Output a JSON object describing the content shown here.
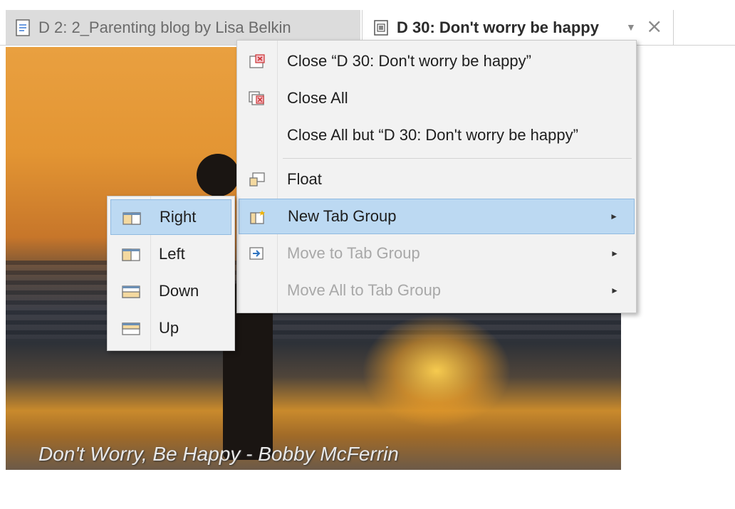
{
  "tabs": [
    {
      "label": "D 2: 2_Parenting blog by Lisa Belkin",
      "active": false,
      "icon": "document-icon"
    },
    {
      "label": "D 30: Don't worry be happy",
      "active": true,
      "icon": "image-document-icon"
    }
  ],
  "tab_controls": {
    "dropdown": "▼",
    "close": "×"
  },
  "content": {
    "caption": "Don't Worry, Be Happy - Bobby McFerrin"
  },
  "context_menu": {
    "items": [
      {
        "label": "Close “D 30: Don't worry be happy”",
        "icon": "close-tab-icon",
        "enabled": true
      },
      {
        "label": "Close All",
        "icon": "close-all-icon",
        "enabled": true
      },
      {
        "label": "Close All but “D 30: Don't worry be happy”",
        "icon": "",
        "enabled": true
      },
      {
        "label": "Float",
        "icon": "float-icon",
        "enabled": true
      },
      {
        "label": "New Tab Group",
        "icon": "new-tab-group-icon",
        "enabled": true,
        "submenu": true
      },
      {
        "label": "Move to Tab Group",
        "icon": "move-tab-group-icon",
        "enabled": false,
        "submenu": true
      },
      {
        "label": "Move All to Tab Group",
        "icon": "",
        "enabled": false,
        "submenu": true
      }
    ],
    "submenu_arrow": "►"
  },
  "submenu": {
    "items": [
      {
        "label": "Right",
        "icon": "split-right-icon"
      },
      {
        "label": "Left",
        "icon": "split-left-icon"
      },
      {
        "label": "Down",
        "icon": "split-down-icon"
      },
      {
        "label": "Up",
        "icon": "split-up-icon"
      }
    ]
  },
  "colors": {
    "highlight": "#bcd9f2",
    "highlight_border": "#8fb9e0",
    "disabled_text": "#a8a8a8",
    "accent": "#4a8ed8"
  }
}
